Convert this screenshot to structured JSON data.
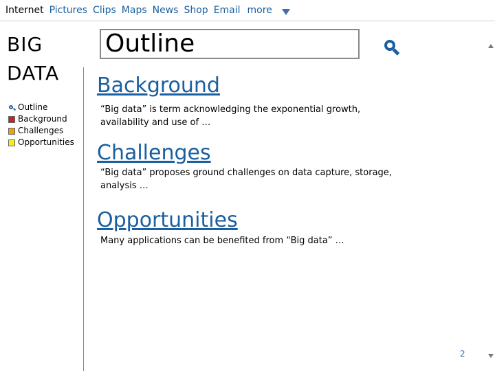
{
  "nav": {
    "items": [
      "Internet",
      "Pictures",
      "Clips",
      "Maps",
      "News",
      "Shop",
      "Email"
    ],
    "more_label": "more"
  },
  "brand": {
    "line1": "BIG",
    "line2": "DATA"
  },
  "toc": {
    "items": [
      {
        "label": "Outline",
        "icon": "magnifier-icon"
      },
      {
        "label": "Background",
        "icon": "red-square-icon",
        "color": "#c0262d"
      },
      {
        "label": "Challenges",
        "icon": "orange-square-icon",
        "color": "#e8a317"
      },
      {
        "label": "Opportunities",
        "icon": "yellow-square-icon",
        "color": "#eeee22"
      }
    ]
  },
  "search": {
    "value": "Outline"
  },
  "sections": [
    {
      "title": "Background",
      "text": "“Big data” is term acknowledging the exponential growth, availability and use of …"
    },
    {
      "title": "Challenges",
      "text": "“Big data” proposes ground challenges on data capture, storage, analysis …"
    },
    {
      "title": "Opportunities",
      "text": "Many applications can be benefited from “Big data” …"
    }
  ],
  "page_number": "2",
  "colors": {
    "link": "#1a5fa0",
    "divider": "#6d8fb3"
  }
}
